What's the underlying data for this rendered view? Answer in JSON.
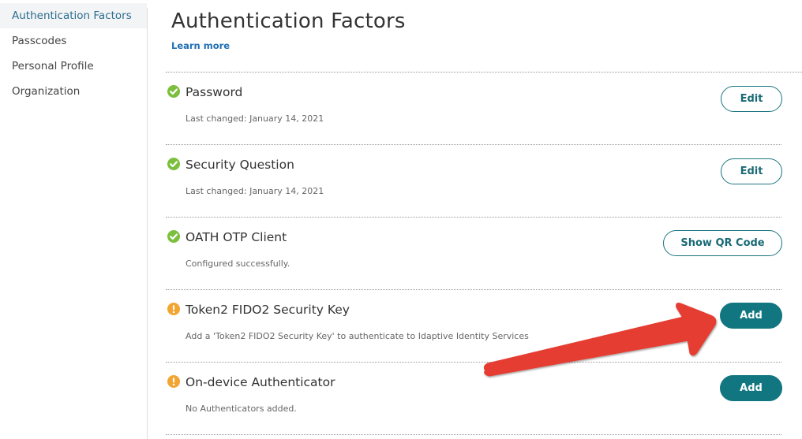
{
  "sidebar": {
    "items": [
      {
        "label": "Authentication Factors",
        "active": true
      },
      {
        "label": "Passcodes",
        "active": false
      },
      {
        "label": "Personal Profile",
        "active": false
      },
      {
        "label": "Organization",
        "active": false
      }
    ]
  },
  "header": {
    "title": "Authentication Factors",
    "learn_more": "Learn more"
  },
  "factors": [
    {
      "name": "Password",
      "description": "Last changed: January 14, 2021",
      "status": "configured",
      "status_icon": "check-circle-icon",
      "button": "Edit",
      "button_style": "outline"
    },
    {
      "name": "Security Question",
      "description": "Last changed: January 14, 2021",
      "status": "configured",
      "status_icon": "check-circle-icon",
      "button": "Edit",
      "button_style": "outline"
    },
    {
      "name": "OATH OTP Client",
      "description": "Configured successfully.",
      "status": "configured",
      "status_icon": "check-circle-icon",
      "button": "Show QR Code",
      "button_style": "outline"
    },
    {
      "name": "Token2 FIDO2 Security Key",
      "description": "Add a 'Token2 FIDO2 Security Key' to authenticate to Idaptive Identity Services",
      "status": "not-configured",
      "status_icon": "exclamation-circle-icon",
      "button": "Add",
      "button_style": "solid"
    },
    {
      "name": "On-device Authenticator",
      "description": "No Authenticators added.",
      "status": "not-configured",
      "status_icon": "exclamation-circle-icon",
      "button": "Add",
      "button_style": "solid"
    }
  ],
  "colors": {
    "accent_teal": "#127680",
    "ok_green": "#7cbf3e",
    "warn_orange": "#f2a531",
    "link_blue": "#1f6fb5",
    "annotation_arrow": "#e53d31"
  },
  "annotation": {
    "type": "arrow",
    "points_to": "Token2 FIDO2 Security Key Add button"
  }
}
